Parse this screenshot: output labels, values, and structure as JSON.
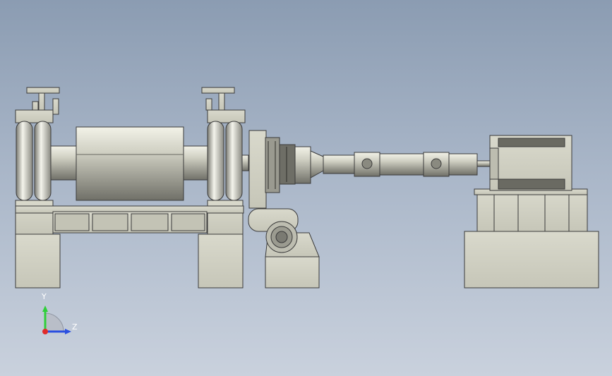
{
  "viewport": {
    "background_top": "#8b9cb2",
    "background_bottom": "#c9d1dd"
  },
  "model": {
    "body_color": "#d1d1c4",
    "edge_color": "#3a3a3a",
    "dark_part_color": "#5f5f5a"
  },
  "triad": {
    "y_label": "Y",
    "z_label": "Z",
    "y_color": "#2fcf3a",
    "z_color": "#2a4fe0",
    "x_color": "#e02a2a"
  }
}
